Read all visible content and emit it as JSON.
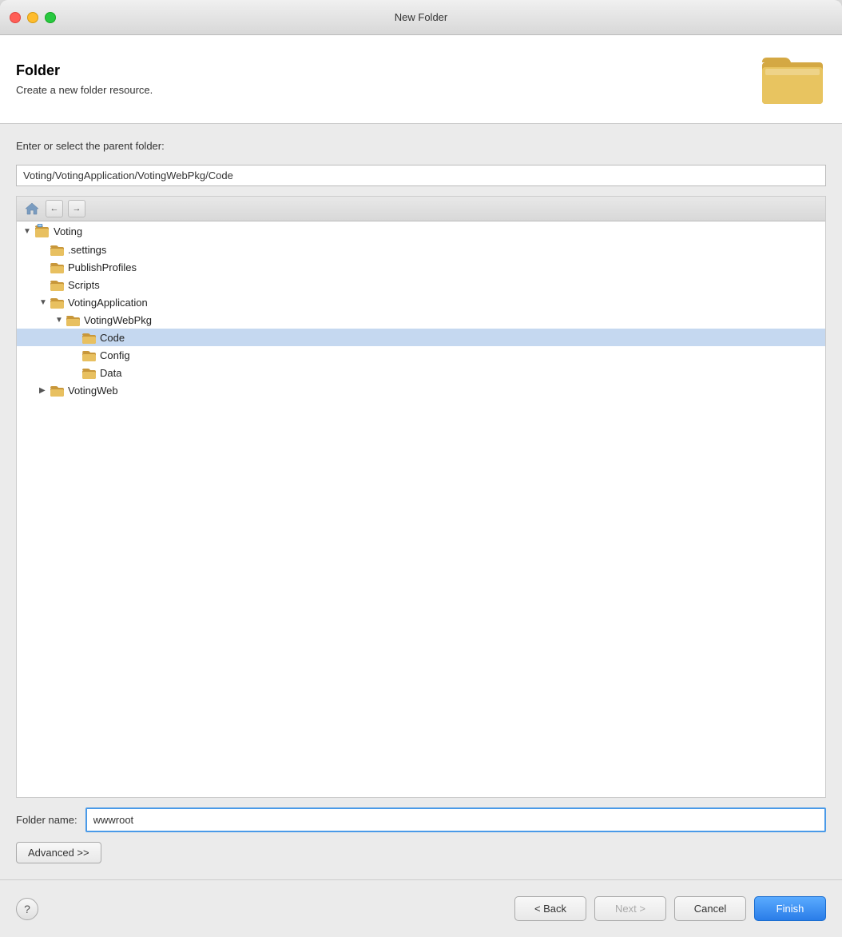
{
  "titleBar": {
    "title": "New Folder"
  },
  "header": {
    "title": "Folder",
    "subtitle": "Create a new folder resource."
  },
  "parentFolder": {
    "label": "Enter or select the parent folder:",
    "value": "Voting/VotingApplication/VotingWebPkg/Code"
  },
  "tree": {
    "items": [
      {
        "id": "voting",
        "label": "Voting",
        "indent": 0,
        "hasArrow": true,
        "arrowOpen": true,
        "type": "project"
      },
      {
        "id": "settings",
        "label": ".settings",
        "indent": 1,
        "hasArrow": false,
        "type": "folder"
      },
      {
        "id": "publishprofiles",
        "label": "PublishProfiles",
        "indent": 1,
        "hasArrow": false,
        "type": "folder"
      },
      {
        "id": "scripts",
        "label": "Scripts",
        "indent": 1,
        "hasArrow": false,
        "type": "folder"
      },
      {
        "id": "votingapplication",
        "label": "VotingApplication",
        "indent": 1,
        "hasArrow": true,
        "arrowOpen": true,
        "type": "folder"
      },
      {
        "id": "votingwebpkg",
        "label": "VotingWebPkg",
        "indent": 2,
        "hasArrow": true,
        "arrowOpen": true,
        "type": "folder"
      },
      {
        "id": "code",
        "label": "Code",
        "indent": 3,
        "hasArrow": false,
        "type": "folder",
        "selected": true
      },
      {
        "id": "config",
        "label": "Config",
        "indent": 3,
        "hasArrow": false,
        "type": "folder"
      },
      {
        "id": "data",
        "label": "Data",
        "indent": 3,
        "hasArrow": false,
        "type": "folder"
      },
      {
        "id": "votingweb",
        "label": "VotingWeb",
        "indent": 1,
        "hasArrow": true,
        "arrowOpen": false,
        "type": "folder"
      }
    ]
  },
  "folderName": {
    "label": "Folder name:",
    "value": "wwwroot",
    "placeholder": ""
  },
  "advanced": {
    "label": "Advanced >>"
  },
  "buttons": {
    "back": "< Back",
    "next": "Next >",
    "cancel": "Cancel",
    "finish": "Finish",
    "help": "?"
  }
}
